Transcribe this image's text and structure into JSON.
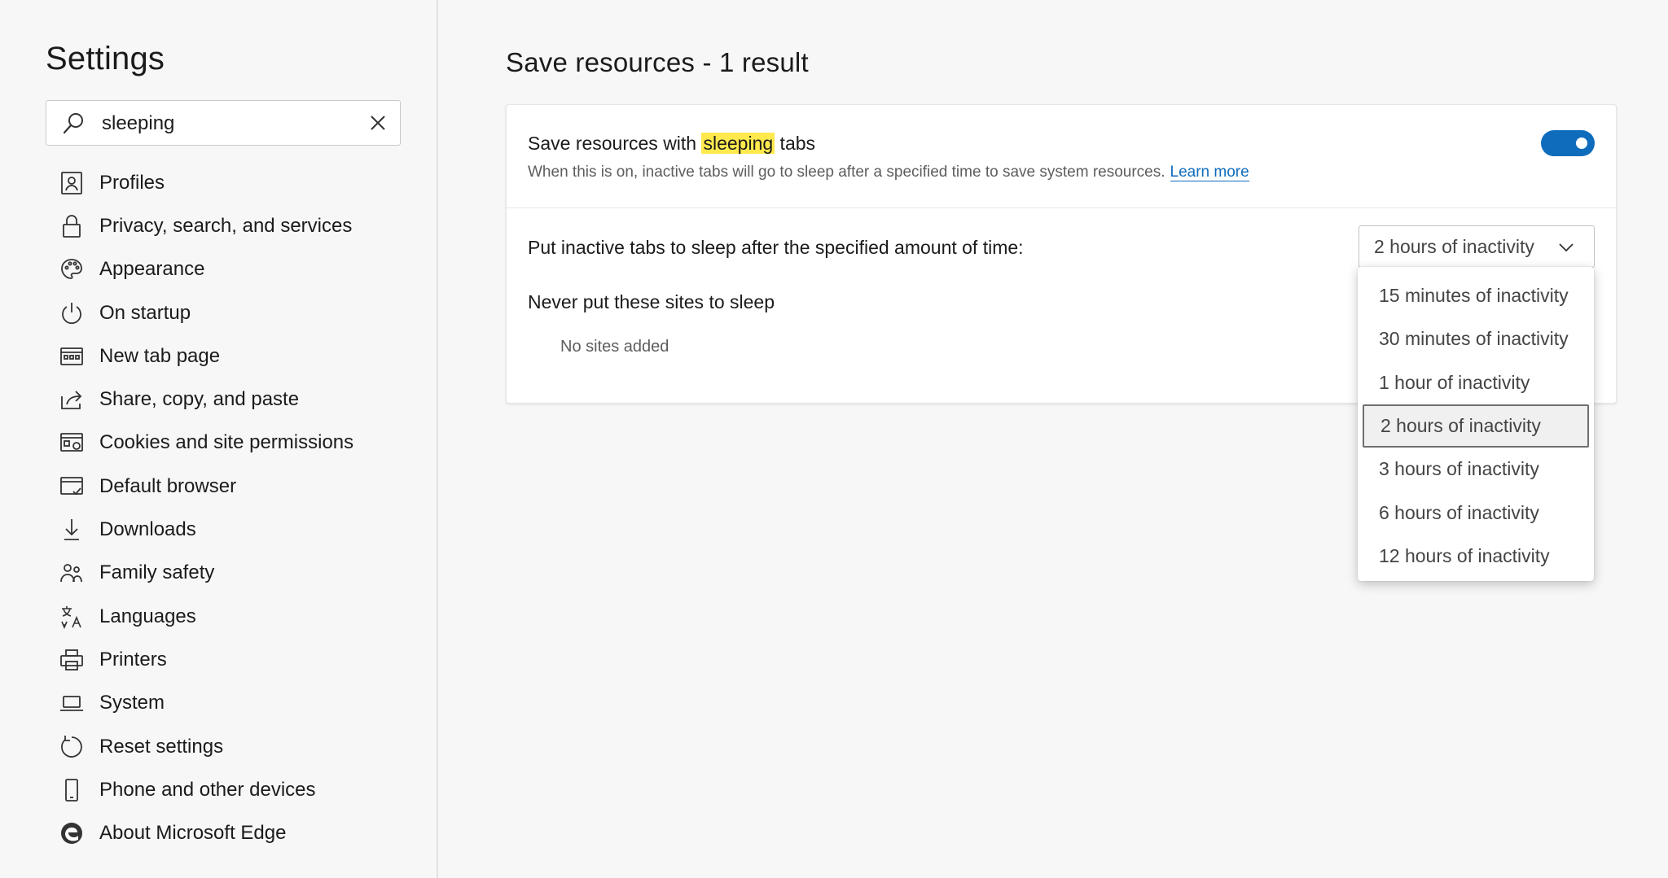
{
  "sidebar": {
    "title": "Settings",
    "search": {
      "value": "sleeping",
      "icon": "search-icon",
      "clear_icon": "close-icon"
    },
    "items": [
      {
        "label": "Profiles",
        "icon": "profile-icon"
      },
      {
        "label": "Privacy, search, and services",
        "icon": "lock-icon"
      },
      {
        "label": "Appearance",
        "icon": "palette-icon"
      },
      {
        "label": "On startup",
        "icon": "power-icon"
      },
      {
        "label": "New tab page",
        "icon": "new-tab-icon"
      },
      {
        "label": "Share, copy, and paste",
        "icon": "share-icon"
      },
      {
        "label": "Cookies and site permissions",
        "icon": "cookies-icon"
      },
      {
        "label": "Default browser",
        "icon": "browser-icon"
      },
      {
        "label": "Downloads",
        "icon": "download-icon"
      },
      {
        "label": "Family safety",
        "icon": "family-icon"
      },
      {
        "label": "Languages",
        "icon": "language-icon"
      },
      {
        "label": "Printers",
        "icon": "printer-icon"
      },
      {
        "label": "System",
        "icon": "laptop-icon"
      },
      {
        "label": "Reset settings",
        "icon": "reset-icon"
      },
      {
        "label": "Phone and other devices",
        "icon": "phone-icon"
      },
      {
        "label": "About Microsoft Edge",
        "icon": "edge-logo-icon"
      }
    ]
  },
  "main": {
    "title": "Save resources - 1 result",
    "sleeping_setting": {
      "title_before": "Save resources with ",
      "title_highlight": "sleeping",
      "title_after": " tabs",
      "description": "When this is on, inactive tabs will go to sleep after a specified time to save system resources.",
      "learn_more": "Learn more",
      "enabled": true
    },
    "sleep_after": {
      "label": "Put inactive tabs to sleep after the specified amount of time:",
      "selected": "2 hours of inactivity",
      "options": [
        "15 minutes of inactivity",
        "30 minutes of inactivity",
        "1 hour of inactivity",
        "2 hours of inactivity",
        "3 hours of inactivity",
        "6 hours of inactivity",
        "12 hours of inactivity"
      ]
    },
    "never_sleep": {
      "label": "Never put these sites to sleep",
      "empty_text": "No sites added"
    }
  },
  "colors": {
    "accent": "#0f6cbd",
    "highlight": "#ffe94d",
    "background": "#f7f7f7"
  }
}
